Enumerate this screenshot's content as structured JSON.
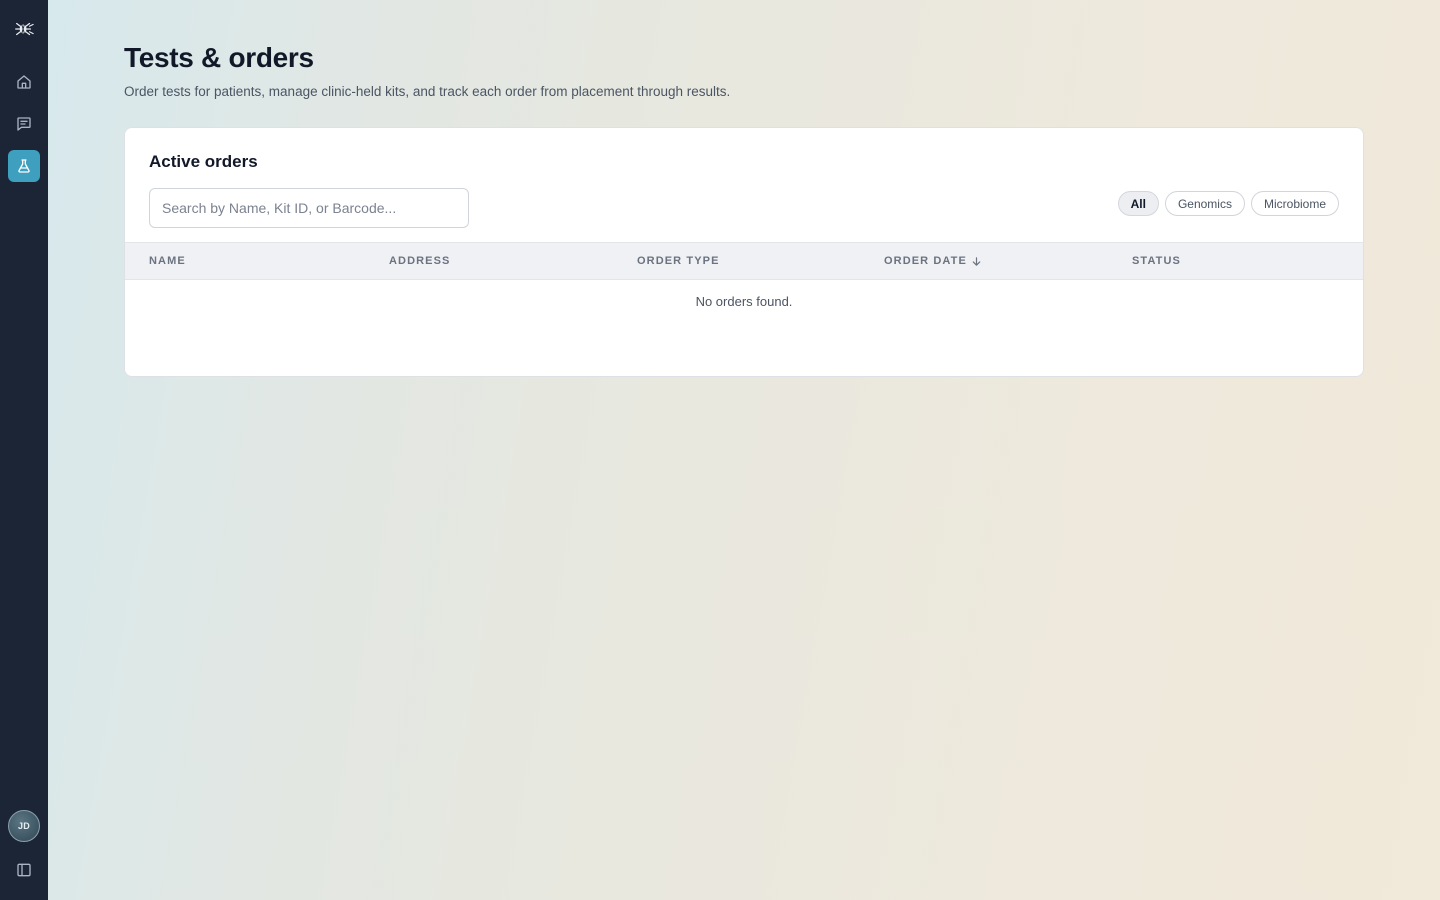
{
  "sidebar": {
    "logo_icon": "dna-spider-logo-icon",
    "items": [
      {
        "name": "home",
        "icon": "home-icon",
        "active": false
      },
      {
        "name": "messages",
        "icon": "message-icon",
        "active": false
      },
      {
        "name": "tests",
        "icon": "flask-icon",
        "active": true
      }
    ],
    "avatar_initials": "JD",
    "collapse_icon": "sidebar-toggle-icon",
    "accent_color": "#3e9fbf",
    "background_color": "#1c2536"
  },
  "page": {
    "title": "Tests & orders",
    "subtitle": "Order tests for patients, manage clinic-held kits, and track each order from placement through results."
  },
  "orders_card": {
    "title": "Active orders",
    "search": {
      "placeholder": "Search by Name, Kit ID, or Barcode...",
      "value": ""
    },
    "filters": [
      {
        "label": "All",
        "active": true
      },
      {
        "label": "Genomics",
        "active": false
      },
      {
        "label": "Microbiome",
        "active": false
      }
    ],
    "columns": [
      "Name",
      "Address",
      "Order type",
      "Order date",
      "Status"
    ],
    "sorted_column": "Order date",
    "sort_direction": "descending",
    "rows": [],
    "empty_message": "No orders found."
  }
}
